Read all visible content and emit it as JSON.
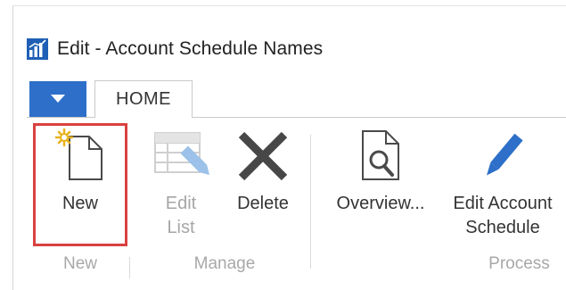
{
  "window": {
    "title": "Edit - Account Schedule Names",
    "app_icon": "chart-icon"
  },
  "tabs": [
    {
      "label": "HOME",
      "selected": true
    }
  ],
  "ribbon": {
    "groups": [
      {
        "label": "New",
        "buttons": [
          {
            "label": "New",
            "icon": "new-document-icon",
            "enabled": true,
            "highlighted": true
          }
        ]
      },
      {
        "label": "Manage",
        "buttons": [
          {
            "label_line1": "Edit",
            "label_line2": "List",
            "icon": "edit-list-icon",
            "enabled": false
          },
          {
            "label": "Delete",
            "icon": "delete-x-icon",
            "enabled": true
          }
        ]
      },
      {
        "label": "Process",
        "buttons": [
          {
            "label": "Overview...",
            "icon": "document-search-icon",
            "enabled": true
          },
          {
            "label_line1": "Edit Account",
            "label_line2": "Schedule",
            "icon": "pencil-icon",
            "enabled": true
          }
        ]
      }
    ]
  },
  "colors": {
    "accent": "#2d6fc9",
    "highlight_border": "#d9413f",
    "disabled_text": "#a6a6a6",
    "icon_dark": "#4a4a4a"
  }
}
